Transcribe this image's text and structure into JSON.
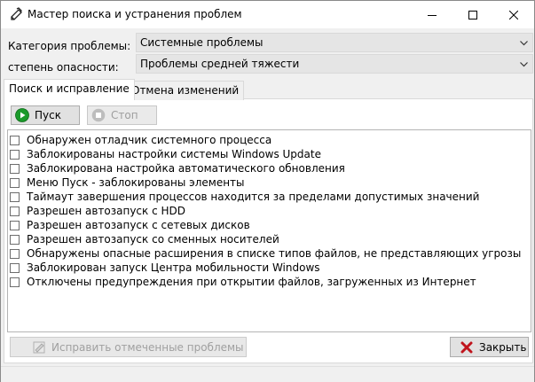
{
  "window": {
    "title": "Мастер поиска и устранения проблем"
  },
  "filters": {
    "category_label": "Категория проблемы:",
    "category_value": "Системные проблемы",
    "severity_label": "степень опасности:",
    "severity_value": "Проблемы средней тяжести"
  },
  "tabs": [
    {
      "label": "Поиск и исправление",
      "active": true
    },
    {
      "label": "Отмена изменений",
      "active": false
    }
  ],
  "toolbar": {
    "start_label": "Пуск",
    "stop_label": "Стоп"
  },
  "problems": [
    {
      "label": "Обнаружен отладчик системного процесса",
      "checked": false
    },
    {
      "label": "Заблокированы настройки системы Windows Update",
      "checked": false
    },
    {
      "label": "Заблокирована настройка автоматического обновления",
      "checked": false
    },
    {
      "label": "Меню Пуск - заблокированы элементы",
      "checked": false
    },
    {
      "label": "Таймаут завершения процессов находится за пределами допустимых значений",
      "checked": false
    },
    {
      "label": "Разрешен автозапуск с HDD",
      "checked": false
    },
    {
      "label": "Разрешен автозапуск с сетевых дисков",
      "checked": false
    },
    {
      "label": "Разрешен автозапуск со сменных носителей",
      "checked": false
    },
    {
      "label": "Обнаружены опасные расширения в списке типов файлов, не представляющих угрозы",
      "checked": false
    },
    {
      "label": "Заблокирован запуск Центра мобильности Windows",
      "checked": false
    },
    {
      "label": "Отключены предупреждения при открытии файлов, загруженных из Интернет",
      "checked": false
    }
  ],
  "footer": {
    "fix_label": "Исправить отмеченные проблемы",
    "close_label": "Закрыть"
  },
  "icons": {
    "start": "play-icon",
    "stop": "stop-icon",
    "fix": "fix-icon",
    "close": "close-x-icon"
  },
  "colors": {
    "start_green": "#1a9a2a",
    "close_red": "#c0141c"
  }
}
